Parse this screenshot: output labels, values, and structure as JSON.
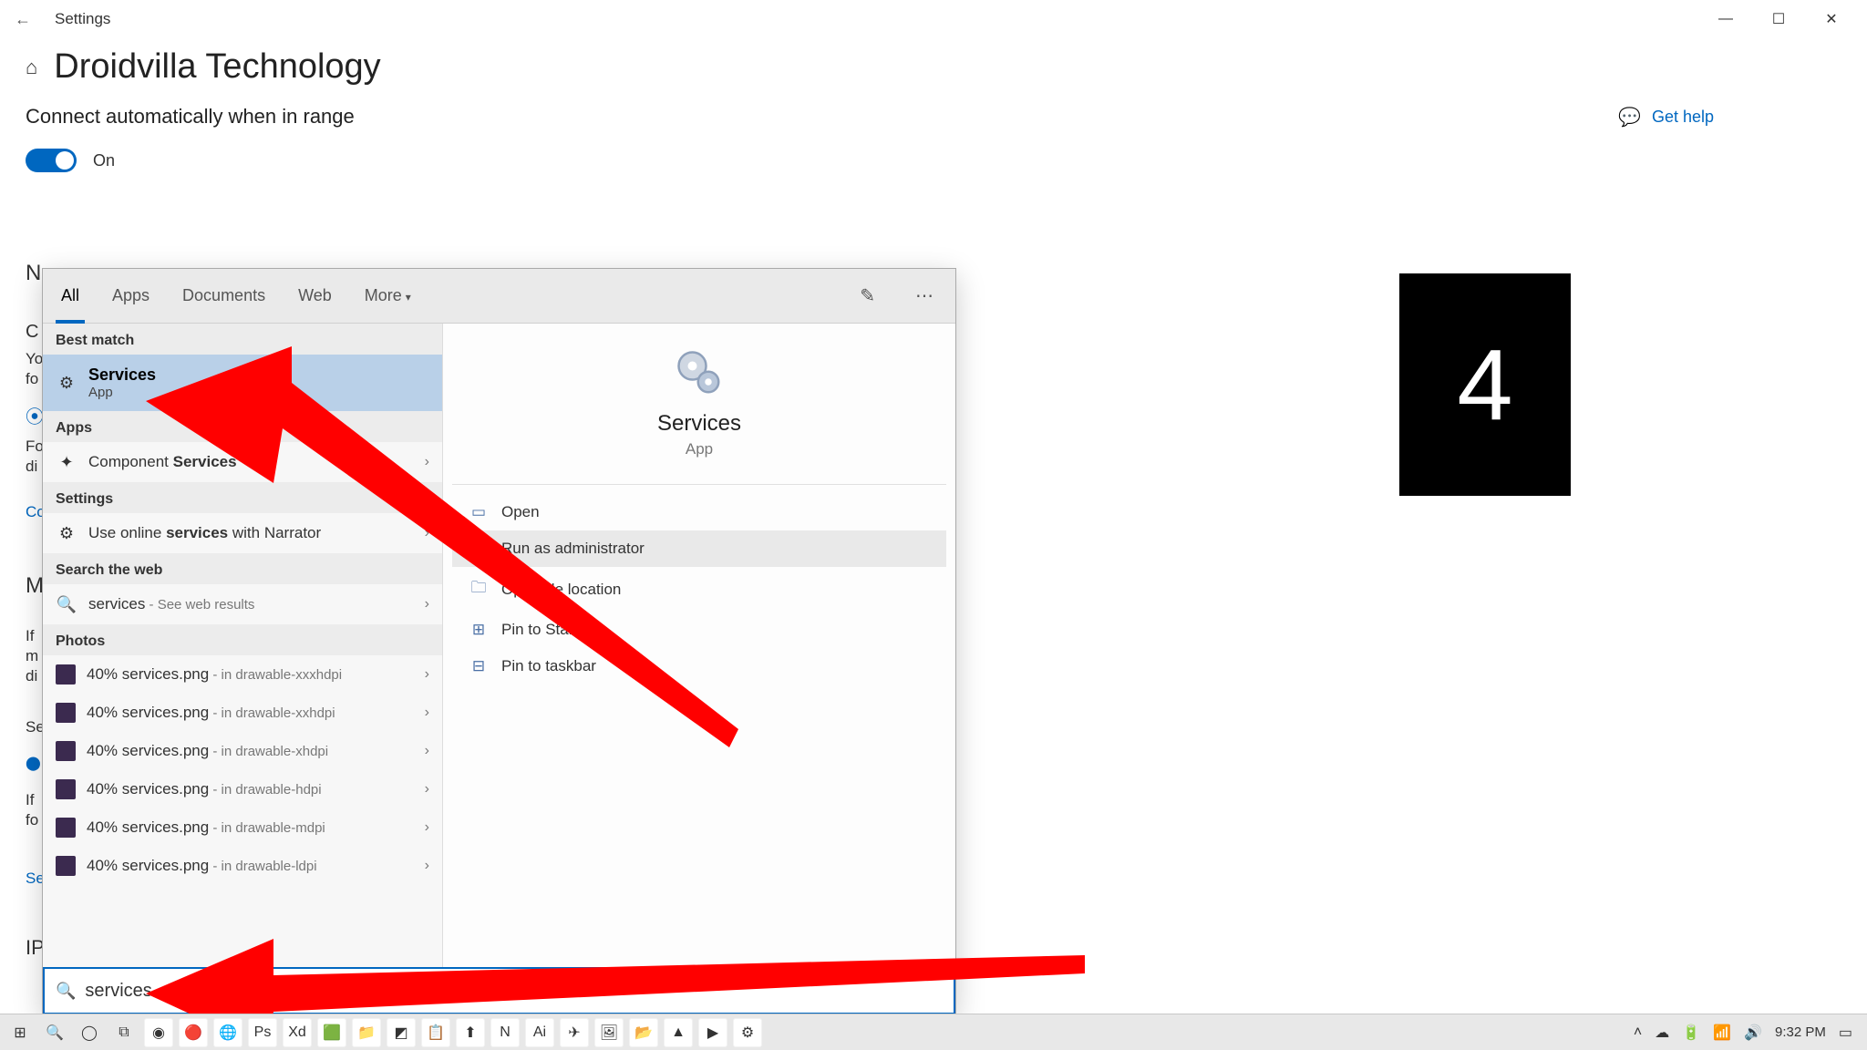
{
  "titlebar": {
    "back_icon": "←",
    "title": "Settings",
    "min": "—",
    "max": "☐",
    "close": "✕"
  },
  "header": {
    "home_icon": "⌂",
    "page_title": "Droidvilla Technology"
  },
  "setting": {
    "label": "Connect automatically when in range",
    "toggle_state": "On"
  },
  "help": {
    "icon": "💬",
    "label": "Get help"
  },
  "countdown": {
    "value": "4"
  },
  "bg": {
    "l1": "N",
    "l2": "C",
    "l3a": "Yo",
    "l3b": "fo",
    "l4": "⦿",
    "l5a": "Fo",
    "l5b": "di",
    "l5c": "Co",
    "l6": "M",
    "l7a": "If",
    "l7b": "m",
    "l7c": "di",
    "l8": "Se",
    "l9": "⬤",
    "l10a": "If",
    "l10b": "fo",
    "l11": "Se",
    "l12": "IP"
  },
  "popup": {
    "tabs": {
      "all": "All",
      "apps": "Apps",
      "documents": "Documents",
      "web": "Web",
      "more": "More",
      "more_caret": "▾"
    },
    "feedback_icon": "✎",
    "menu_icon": "⋯",
    "sections": {
      "best": "Best match",
      "apps": "Apps",
      "settings": "Settings",
      "web": "Search the web",
      "photos": "Photos"
    },
    "best": {
      "title": "Services",
      "subtitle": "App",
      "icon": "⚙"
    },
    "apps_item": {
      "prefix": "Component ",
      "bold": "Services",
      "chev": "›"
    },
    "settings_item": {
      "prefix": "Use online ",
      "bold": "services",
      "suffix": " with Narrator",
      "chev": "›"
    },
    "web_item": {
      "icon": "🔍",
      "term": "services",
      "extra": " - See web results",
      "chev": "›"
    },
    "photos": [
      {
        "name": "40% services.png",
        "loc": " - in drawable-xxxhdpi"
      },
      {
        "name": "40% services.png",
        "loc": " - in drawable-xxhdpi"
      },
      {
        "name": "40% services.png",
        "loc": " - in drawable-xhdpi"
      },
      {
        "name": "40% services.png",
        "loc": " - in drawable-hdpi"
      },
      {
        "name": "40% services.png",
        "loc": " - in drawable-mdpi"
      },
      {
        "name": "40% services.png",
        "loc": " - in drawable-ldpi"
      }
    ],
    "preview": {
      "name": "Services",
      "type": "App"
    },
    "actions": {
      "open": "Open",
      "open_icon": "▭",
      "admin": "Run as administrator",
      "admin_icon": "🛡",
      "filelocation": "Open file location",
      "filelocation_icon": "🗀",
      "pinstart": "Pin to Start",
      "pinstart_icon": "⊞",
      "pintaskbar": "Pin to taskbar",
      "pintaskbar_icon": "⊟"
    },
    "search": {
      "icon": "🔍",
      "value": "services"
    }
  },
  "taskbar": {
    "start": "⊞",
    "search": "🔍",
    "cortana": "◯",
    "taskview": "⧉",
    "apps": [
      "◉",
      "🔴",
      "🌐",
      "Ps",
      "Xd",
      "🟩",
      "📁",
      "◩",
      "📋",
      "⬆",
      "N",
      "Ai",
      "✈",
      "🖼",
      "📂",
      "▲",
      "▶",
      "⚙"
    ],
    "tray": {
      "up": "˄",
      "cloud": "☁",
      "batt": "🔋",
      "wifi": "📶",
      "vol": "🔊"
    },
    "clock": "9:32 PM",
    "notif": "▭"
  }
}
